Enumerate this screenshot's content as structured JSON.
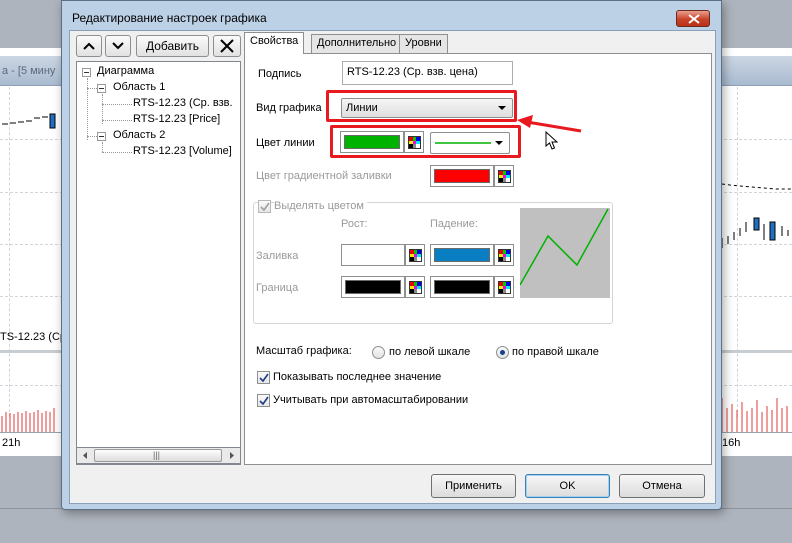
{
  "background": {
    "window_title_fragment": "а - [5 мину",
    "series_label": "TS-12.23 (Ср",
    "axis_left_label": "21h",
    "axis_right_label": "16h"
  },
  "dialog": {
    "title": "Редактирование настроек графика",
    "toolbar": {
      "add_label": "Добавить"
    },
    "tree": {
      "root": "Диаграмма",
      "areas": [
        {
          "label": "Область 1",
          "children": [
            "RTS-12.23 (Ср. взв.",
            "RTS-12.23 [Price]"
          ]
        },
        {
          "label": "Область 2",
          "children": [
            "RTS-12.23 [Volume]"
          ]
        }
      ],
      "scroll_grip": "|||"
    },
    "tabs": [
      "Свойства",
      "Дополнительно",
      "Уровни"
    ],
    "properties": {
      "caption_label": "Подпись",
      "caption_value": "RTS-12.23 (Ср. взв. цена)",
      "chart_type_label": "Вид графика",
      "chart_type_value": "Линии",
      "line_color_label": "Цвет линии",
      "line_color": "#00b200",
      "gradient_label": "Цвет градиентной заливки",
      "gradient_color": "#ff0000",
      "highlight_label": "Выделять цветом",
      "rise_label": "Рост:",
      "fall_label": "Падение:",
      "fill_label": "Заливка",
      "border_label": "Граница",
      "fill_rise_color": "#ffffff",
      "fill_fall_color": "#0a7ec2",
      "border_rise_color": "#000000",
      "border_fall_color": "#000000",
      "scale_label": "Масштаб графика:",
      "scale_left": "по левой шкале",
      "scale_right": "по правой шкале",
      "scale_selected": "right",
      "show_last_value": "Показывать последнее значение",
      "use_in_autoscale": "Учитывать при автомасштабировании"
    },
    "buttons": {
      "apply": "Применить",
      "ok": "OK",
      "cancel": "Отмена"
    }
  },
  "colors": {
    "dialog_frame": "#bcd0e6",
    "highlight_red": "#e8191f",
    "preview_bg": "#c0c0c0",
    "preview_line": "#00b200"
  }
}
